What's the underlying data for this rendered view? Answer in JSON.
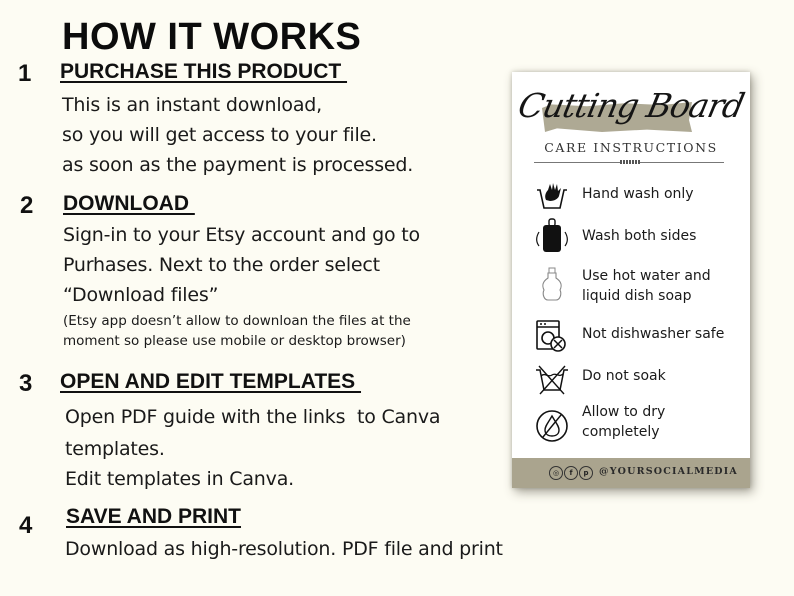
{
  "title": "HOW IT WORKS",
  "steps": [
    {
      "number": "1",
      "heading": "PURCHASE THIS PRODUCT ",
      "lines": [
        "This is an instant download,",
        "so you will get access to your file.",
        "as soon as the payment is processed."
      ]
    },
    {
      "number": "2",
      "heading": "DOWNLOAD ",
      "lines": [
        "Sign-in to your Etsy account and go to",
        "Purhases. Next to the order select",
        "“Download files”"
      ],
      "note_lines": [
        "(Etsy app doesn’t allow to downloan the files at the",
        "moment so please use mobile or desktop browser)"
      ]
    },
    {
      "number": "3",
      "heading": "OPEN AND EDIT TEMPLATES ",
      "lines": [
        "Open PDF guide with the links  to Canva",
        "templates.",
        "Edit templates in Canva."
      ]
    },
    {
      "number": "4",
      "heading": "SAVE AND PRINT",
      "lines": [
        "Download as high-resolution. PDF file and print"
      ]
    }
  ],
  "card": {
    "title": "Cutting Board",
    "subtitle": "CARE INSTRUCTIONS",
    "accent_color": "#aaa48e",
    "items": [
      {
        "icon": "hand-wash-icon",
        "text": "Hand wash only"
      },
      {
        "icon": "cutting-board-flip-icon",
        "text": "Wash both sides"
      },
      {
        "icon": "soap-bottle-icon",
        "text": "Use hot water and\nliquid dish soap"
      },
      {
        "icon": "no-dishwasher-icon",
        "text": "Not dishwasher safe"
      },
      {
        "icon": "do-not-soak-icon",
        "text": "Do not soak"
      },
      {
        "icon": "dry-icon",
        "text": "Allow to dry\ncompletely"
      }
    ],
    "footer": {
      "social_icons": [
        "instagram-icon",
        "facebook-icon",
        "pinterest-icon"
      ],
      "handle": "@YOURSOCIALMEDIA"
    }
  }
}
